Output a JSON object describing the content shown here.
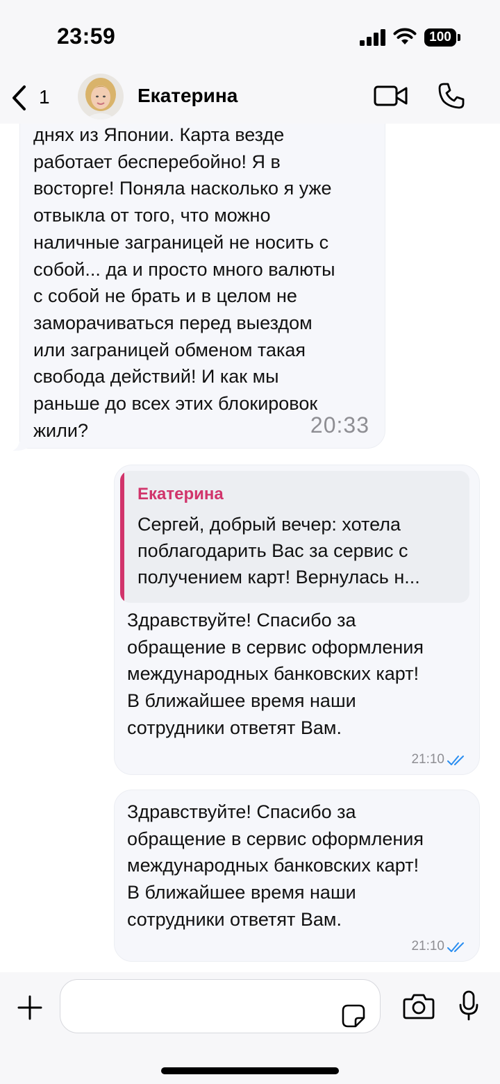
{
  "status_bar": {
    "time": "23:59",
    "battery": "100"
  },
  "header": {
    "back_count": "1",
    "contact_name": "Екатерина"
  },
  "messages": [
    {
      "direction": "incoming",
      "text": "днях из Японии. Карта везде\nработает бесперебойно! Я в\nвосторге! Поняла насколько я уже\nотвыкла от того, что можно\nналичные заграницей не носить с\nсобой... да и просто много валюты\nс собой не брать и в целом не\nзаморачиваться перед выездом\nили заграницей обменом такая\nсвобода действий! И как мы\nраньше до всех этих блокировок\nжили?",
      "time": "20:33"
    },
    {
      "direction": "outgoing",
      "reply": {
        "name": "Екатерина",
        "text": "Сергей, добрый вечер: хотела\nпоблагодарить Вас за сервис с\nполучением карт! Вернулась н..."
      },
      "text": "Здравствуйте! Спасибо за\nобращение в сервис оформления\nмеждународных банковских карт!\nВ ближайшее время наши\nсотрудники ответят Вам.",
      "time": "21:10",
      "status_icon": "double-check-icon"
    },
    {
      "direction": "outgoing",
      "text": "Здравствуйте! Спасибо за\nобращение в сервис оформления\nмеждународных банковских карт!\nВ ближайшее время наши\nсотрудники ответят Вам.",
      "time": "21:10",
      "status_icon": "double-check-icon"
    }
  ],
  "input": {
    "value": "",
    "placeholder": ""
  },
  "colors": {
    "accent": "#d1346b",
    "read_check": "#2a8ef0",
    "bubble_bg": "#f6f7fb",
    "bar_bg": "#f7f7f9"
  },
  "icons": [
    "signal-icon",
    "wifi-icon",
    "chevron-left-icon",
    "video-camera-icon",
    "phone-icon",
    "plus-icon",
    "sticker-icon",
    "camera-icon",
    "microphone-icon"
  ]
}
